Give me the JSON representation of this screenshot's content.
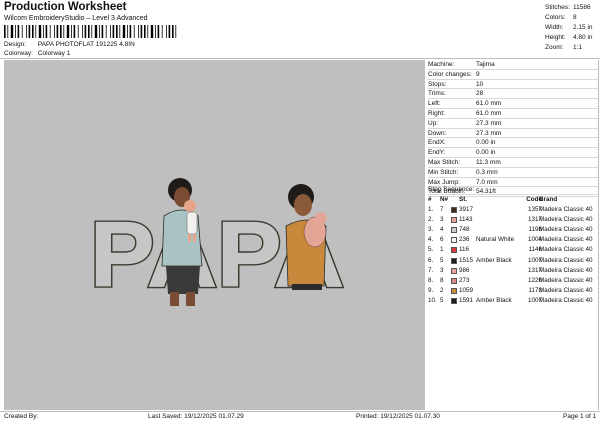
{
  "header": {
    "title": "Production Worksheet",
    "subtitle": "Wilcom EmbroideryStudio – Level 3 Advanced",
    "design_label": "Design:",
    "design_value": "PAPA PHOTOFLAT 191225 4,8IN",
    "colorway_label": "Colorway:",
    "colorway_value": "Colorway 1"
  },
  "stats": [
    {
      "k": "Stitches:",
      "v": "11586"
    },
    {
      "k": "Colors:",
      "v": "8"
    },
    {
      "k": "Width:",
      "v": "2.15 in"
    },
    {
      "k": "Height:",
      "v": "4.80 in"
    },
    {
      "k": "Zoom:",
      "v": "1:1"
    }
  ],
  "design_art": {
    "text": "PAPA"
  },
  "specs": [
    {
      "k": "Machine:",
      "v": "Tajima"
    },
    {
      "k": "Color changes:",
      "v": "9"
    },
    {
      "k": "Stops:",
      "v": "10"
    },
    {
      "k": "Trims:",
      "v": "28"
    },
    {
      "k": "Left:",
      "v": "61.0 mm"
    },
    {
      "k": "Right:",
      "v": "61.0 mm"
    },
    {
      "k": "Up:",
      "v": "27.3 mm"
    },
    {
      "k": "Down:",
      "v": "27.3 mm"
    },
    {
      "k": "EndX:",
      "v": "0.00 in"
    },
    {
      "k": "EndY:",
      "v": "0.00 in"
    },
    {
      "k": "Max Stitch:",
      "v": "11.3 mm"
    },
    {
      "k": "Min Stitch:",
      "v": "0.3 mm"
    },
    {
      "k": "Max Jump:",
      "v": "7.0 mm"
    },
    {
      "k": "Total Bobbin:",
      "v": "54.31ft"
    }
  ],
  "stop_sequence": {
    "title": "Stop Sequence:",
    "headers": {
      "num": "#",
      "n": "N#",
      "st": "St.",
      "code": "Code",
      "brand": "Brand"
    },
    "rows": [
      {
        "num": "1.",
        "n": "7",
        "color": "#3a2e22",
        "st": "3917",
        "desc": "",
        "stitches": "",
        "code": "1357",
        "brand": "Madeira Classic 40"
      },
      {
        "num": "2.",
        "n": "3",
        "color": "#e8a49c",
        "st": "1143",
        "desc": "",
        "stitches": "",
        "code": "1317",
        "brand": "Madeira Classic 40"
      },
      {
        "num": "3.",
        "n": "4",
        "color": "#c9ced2",
        "st": "748",
        "desc": "",
        "stitches": "",
        "code": "1198",
        "brand": "Madeira Classic 40"
      },
      {
        "num": "4.",
        "n": "6",
        "color": "#f4f4f4",
        "st": "236",
        "desc": "Natural White",
        "stitches": "",
        "code": "1004",
        "brand": "Madeira Classic 40"
      },
      {
        "num": "5.",
        "n": "1",
        "color": "#d93a3a",
        "st": "116",
        "desc": "",
        "stitches": "",
        "code": "1146",
        "brand": "Madeira Classic 40"
      },
      {
        "num": "6.",
        "n": "5",
        "color": "#1e1e1e",
        "st": "1515",
        "desc": "Amber Black",
        "stitches": "",
        "code": "1007",
        "brand": "Madeira Classic 40"
      },
      {
        "num": "7.",
        "n": "3",
        "color": "#e8a49c",
        "st": "986",
        "desc": "",
        "stitches": "",
        "code": "1317",
        "brand": "Madeira Classic 40"
      },
      {
        "num": "8.",
        "n": "8",
        "color": "#d88a8a",
        "st": "273",
        "desc": "",
        "stitches": "",
        "code": "1220",
        "brand": "Madeira Classic 40"
      },
      {
        "num": "9.",
        "n": "2",
        "color": "#c68b3a",
        "st": "1059",
        "desc": "",
        "stitches": "",
        "code": "1173",
        "brand": "Madeira Classic 40"
      },
      {
        "num": "10.",
        "n": "5",
        "color": "#1e1e1e",
        "st": "1591",
        "desc": "Amber Black",
        "stitches": "",
        "code": "1007",
        "brand": "Madeira Classic 40"
      }
    ]
  },
  "footer": {
    "created": "Created By:",
    "saved": "Last Saved: 19/12/2025 01.07.29",
    "printed": "Printed: 19/12/2025 01.07.30",
    "page": "Page 1 of 1"
  }
}
